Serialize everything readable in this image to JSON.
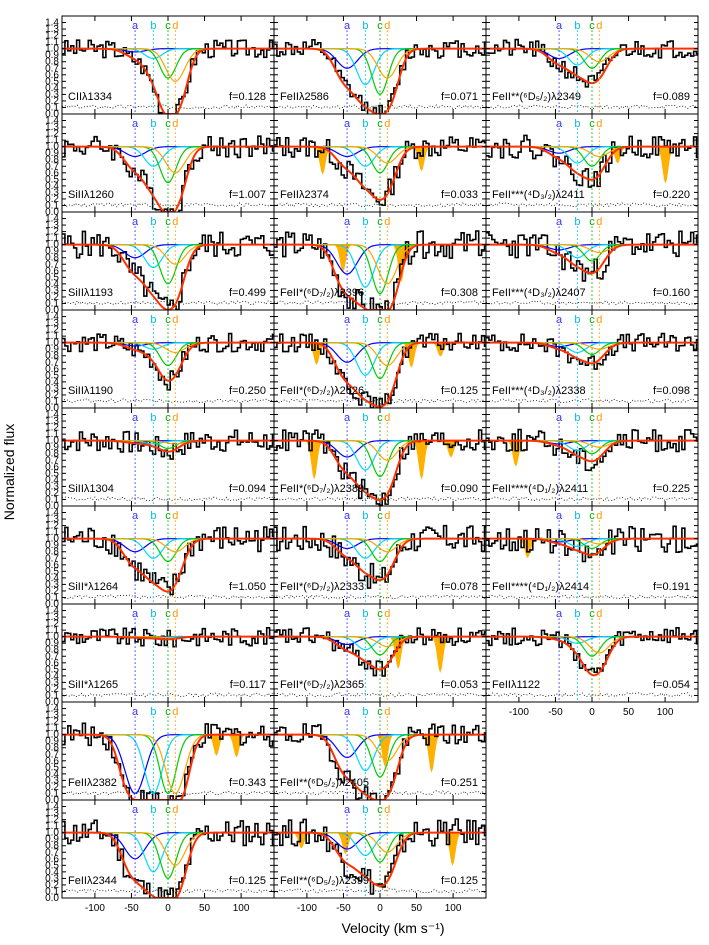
{
  "figure": {
    "ylabel": "Normalized flux",
    "xlabel": "Velocity (km s⁻¹)",
    "component_labels": [
      "a",
      "b",
      "c",
      "d"
    ],
    "component_velocities_kms": [
      -45,
      -20,
      0,
      10
    ],
    "colors": {
      "data": "#000000",
      "total_fit": "#ff3000",
      "component_a": "#0000ff",
      "component_b": "#00d8ff",
      "component_c": "#00cc00",
      "component_d": "#ffa500",
      "label_a": "#3333ff",
      "label_b": "#00c0e0",
      "label_c": "#00b000",
      "label_d": "#ff9900",
      "blend_fill": "#ffb000",
      "error": "#000000"
    }
  },
  "chart_data": [
    {
      "type": "line",
      "line": "CIIλ1334",
      "f": "f=0.128",
      "depths": [
        0.05,
        0.15,
        0.45,
        0.5
      ],
      "blend": false,
      "total_depth": 0.9
    },
    {
      "type": "line",
      "line": "SiIIλ1260",
      "f": "f=1.007",
      "depths": [
        0.15,
        0.3,
        0.55,
        0.4
      ],
      "blend": false,
      "total_depth": 0.9
    },
    {
      "type": "line",
      "line": "SiIIλ1193",
      "f": "f=0.499",
      "depths": [
        0.2,
        0.35,
        0.6,
        0.3
      ],
      "blend": false,
      "total_depth": 0.9
    },
    {
      "type": "line",
      "line": "SiIIλ1190",
      "f": "f=0.250",
      "depths": [
        0.05,
        0.1,
        0.35,
        0.15
      ],
      "blend": false,
      "total_depth": 0.55
    },
    {
      "type": "line",
      "line": "SiIIλ1304",
      "f": "f=0.094",
      "depths": [
        0.03,
        0.05,
        0.12,
        0.05
      ],
      "blend": false,
      "total_depth": 0.2
    },
    {
      "type": "line",
      "line": "SiII*λ1264",
      "f": "f=1.050",
      "depths": [
        0.2,
        0.3,
        0.35,
        0.2
      ],
      "blend": false,
      "total_depth": 0.7
    },
    {
      "type": "line",
      "line": "SiII*λ1265",
      "f": "f=0.117",
      "depths": [
        0.02,
        0.03,
        0.04,
        0.02
      ],
      "blend": false,
      "total_depth": 0.08
    },
    {
      "type": "line",
      "line": "FeIIλ2382",
      "f": "f=0.343",
      "depths": [
        0.9,
        0.9,
        0.9,
        0.9
      ],
      "blend": true,
      "total_depth": 1.0
    },
    {
      "type": "line",
      "line": "FeIIλ2344",
      "f": "f=0.125",
      "depths": [
        0.4,
        0.6,
        0.7,
        0.5
      ],
      "blend": false,
      "total_depth": 0.95
    },
    {
      "type": "line",
      "line": "FeIIλ2586",
      "f": "f=0.071",
      "depths": [
        0.3,
        0.55,
        0.7,
        0.45
      ],
      "blend": false,
      "total_depth": 0.9
    },
    {
      "type": "line",
      "line": "FeIIλ2374",
      "f": "f=0.033",
      "depths": [
        0.15,
        0.3,
        0.4,
        0.25
      ],
      "blend": true,
      "total_depth": 0.7
    },
    {
      "type": "line",
      "line": "FeII*(⁶D₇/₂)λ2396",
      "f": "f=0.308",
      "depths": [
        0.45,
        0.65,
        0.75,
        0.6
      ],
      "blend": true,
      "total_depth": 0.95
    },
    {
      "type": "line",
      "line": "FeII*(⁶D₇/₂)λ2626",
      "f": "f=0.125",
      "depths": [
        0.3,
        0.5,
        0.55,
        0.35
      ],
      "blend": true,
      "total_depth": 0.85
    },
    {
      "type": "line",
      "line": "FeII*(⁶D₇/₂)λ2389",
      "f": "f=0.090",
      "depths": [
        0.25,
        0.45,
        0.55,
        0.3
      ],
      "blend": true,
      "total_depth": 0.8
    },
    {
      "type": "line",
      "line": "FeII*(⁶D₇/₂)λ2333",
      "f": "f=0.078",
      "depths": [
        0.15,
        0.3,
        0.35,
        0.2
      ],
      "blend": false,
      "total_depth": 0.55
    },
    {
      "type": "line",
      "line": "FeII*(⁶D₇/₂)λ2365",
      "f": "f=0.053",
      "depths": [
        0.12,
        0.2,
        0.28,
        0.15
      ],
      "blend": true,
      "total_depth": 0.45
    },
    {
      "type": "line",
      "line": "FeII**(⁶D₅/₂)λ2405",
      "f": "f=0.251",
      "depths": [
        0.35,
        0.55,
        0.65,
        0.4
      ],
      "blend": true,
      "total_depth": 0.9
    },
    {
      "type": "line",
      "line": "FeII**(⁶D₅/₂)λ2399",
      "f": "f=0.125",
      "depths": [
        0.25,
        0.35,
        0.45,
        0.3
      ],
      "blend": true,
      "total_depth": 0.7
    },
    {
      "type": "line",
      "line": "FeII**(⁶D₅/₂)λ2349",
      "f": "f=0.089",
      "depths": [
        0.15,
        0.25,
        0.3,
        0.2
      ],
      "blend": false,
      "total_depth": 0.45
    },
    {
      "type": "line",
      "line": "FeII***(⁴D₃/₂)λ2411",
      "f": "f=0.220",
      "depths": [
        0.1,
        0.25,
        0.3,
        0.15
      ],
      "blend": true,
      "total_depth": 0.45
    },
    {
      "type": "line",
      "line": "FeII***(⁴D₃/₂)λ2407",
      "f": "f=0.160",
      "depths": [
        0.08,
        0.2,
        0.25,
        0.12
      ],
      "blend": false,
      "total_depth": 0.4
    },
    {
      "type": "line",
      "line": "FeII***(⁴D₃/₂)λ2338",
      "f": "f=0.098",
      "depths": [
        0.06,
        0.15,
        0.18,
        0.1
      ],
      "blend": false,
      "total_depth": 0.3
    },
    {
      "type": "line",
      "line": "FeII****(⁴D₁/₂)λ2411",
      "f": "f=0.225",
      "depths": [
        0.05,
        0.15,
        0.2,
        0.1
      ],
      "blend": true,
      "total_depth": 0.3
    },
    {
      "type": "line",
      "line": "FeII****(⁴D₁/₂)λ2414",
      "f": "f=0.191",
      "depths": [
        0.05,
        0.12,
        0.15,
        0.08
      ],
      "blend": true,
      "total_depth": 0.25
    },
    {
      "type": "line",
      "line": "FeIIλ1122",
      "f": "f=0.054",
      "depths": [
        0.02,
        0.1,
        0.3,
        0.25
      ],
      "blend": false,
      "total_depth": 0.5
    }
  ],
  "axes": {
    "xlim": [
      -145,
      145
    ],
    "ylim": [
      0.0,
      1.5
    ],
    "xticks": [
      -100,
      -50,
      0,
      50,
      100
    ],
    "xtick_labels": [
      "-100",
      "-50",
      "0",
      "50",
      "100"
    ],
    "yticks": [
      0.0,
      0.1,
      0.2,
      0.3,
      0.4,
      0.5,
      0.6,
      0.7,
      0.8,
      0.9,
      1.0,
      1.1,
      1.2,
      1.3,
      1.4
    ],
    "ytick_labels": [
      "0.0",
      "0.1",
      "0.2",
      "0.3",
      "0.4",
      "0.5",
      "0.6",
      "0.7",
      "0.8",
      "0.9",
      "1.0",
      "1.1",
      "1.2",
      "1.3",
      "1.4"
    ]
  }
}
